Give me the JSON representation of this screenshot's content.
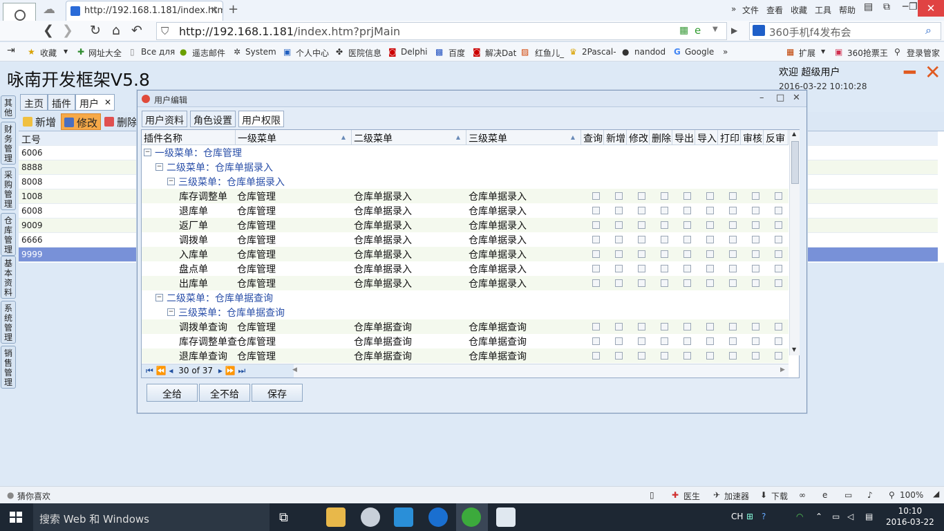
{
  "browser": {
    "tab_title": "http://192.168.1.181/index.htm",
    "menu": [
      "文件",
      "查看",
      "收藏",
      "工具",
      "帮助"
    ],
    "address_host": "http://192.168.1.181",
    "address_path": "/index.htm?prjMain",
    "search_text": "360手机f4发布会",
    "bookmarks": [
      "收藏",
      "网址大全",
      "Все для",
      "遥志邮件",
      "System",
      "个人中心",
      "医院信息",
      "Delphi",
      "百度",
      "解决Dat",
      "红鱼儿_",
      "2Pascal-",
      "nandod",
      "Google",
      "扩展",
      "360抢票王",
      "登录管家"
    ]
  },
  "app": {
    "title": "咏南开发框架V5.8",
    "welcome": "欢迎 超级用户",
    "datetime": "2016-03-22 10:10:28",
    "side_tabs": [
      "其他",
      "财务管理",
      "采购管理",
      "仓库管理",
      "基本资料",
      "系统管理",
      "销售管理"
    ],
    "page_tabs": [
      "主页",
      "插件",
      "用户"
    ],
    "toolbar": {
      "add": "新增",
      "edit": "修改",
      "delete": "删除"
    },
    "grid": {
      "header": "工号",
      "rows": [
        "6006",
        "8888",
        "8008",
        "1008",
        "6008",
        "9009",
        "6666",
        "9999"
      ]
    }
  },
  "dialog": {
    "title": "用户编辑",
    "tabs": [
      "用户资料",
      "角色设置",
      "用户权限"
    ],
    "columns": [
      "插件名称",
      "一级菜单",
      "二级菜单",
      "三级菜单",
      "查询",
      "新增",
      "修改",
      "删除",
      "导出",
      "导入",
      "打印",
      "审核",
      "反审"
    ],
    "group1": "一级菜单：仓库管理",
    "group2a": "二级菜单：仓库单据录入",
    "group3a": "三级菜单：仓库单据录入",
    "rows_a": [
      {
        "name": "库存调整单",
        "l1": "仓库管理",
        "l2": "仓库单据录入",
        "l3": "仓库单据录入"
      },
      {
        "name": "退库单",
        "l1": "仓库管理",
        "l2": "仓库单据录入",
        "l3": "仓库单据录入"
      },
      {
        "name": "返厂单",
        "l1": "仓库管理",
        "l2": "仓库单据录入",
        "l3": "仓库单据录入"
      },
      {
        "name": "调拨单",
        "l1": "仓库管理",
        "l2": "仓库单据录入",
        "l3": "仓库单据录入"
      },
      {
        "name": "入库单",
        "l1": "仓库管理",
        "l2": "仓库单据录入",
        "l3": "仓库单据录入"
      },
      {
        "name": "盘点单",
        "l1": "仓库管理",
        "l2": "仓库单据录入",
        "l3": "仓库单据录入"
      },
      {
        "name": "出库单",
        "l1": "仓库管理",
        "l2": "仓库单据录入",
        "l3": "仓库单据录入"
      }
    ],
    "group2b": "二级菜单：仓库单据查询",
    "group3b": "三级菜单：仓库单据查询",
    "rows_b": [
      {
        "name": "调拨单查询",
        "l1": "仓库管理",
        "l2": "仓库单据查询",
        "l3": "仓库单据查询"
      },
      {
        "name": "库存调整单查询",
        "l1": "仓库管理",
        "l2": "仓库单据查询",
        "l3": "仓库单据查询"
      },
      {
        "name": "退库单查询",
        "l1": "仓库管理",
        "l2": "仓库单据查询",
        "l3": "仓库单据查询"
      }
    ],
    "pager": "30 of 37",
    "buttons": {
      "all": "全给",
      "none": "全不给",
      "save": "保存"
    }
  },
  "statusbar": {
    "left": "猜你喜欢",
    "items": [
      "医生",
      "加速器",
      "下载"
    ],
    "zoom": "100%"
  },
  "taskbar": {
    "search": "搜索 Web 和 Windows",
    "time": "10:10",
    "date": "2016-03-22",
    "ime": "CH"
  }
}
